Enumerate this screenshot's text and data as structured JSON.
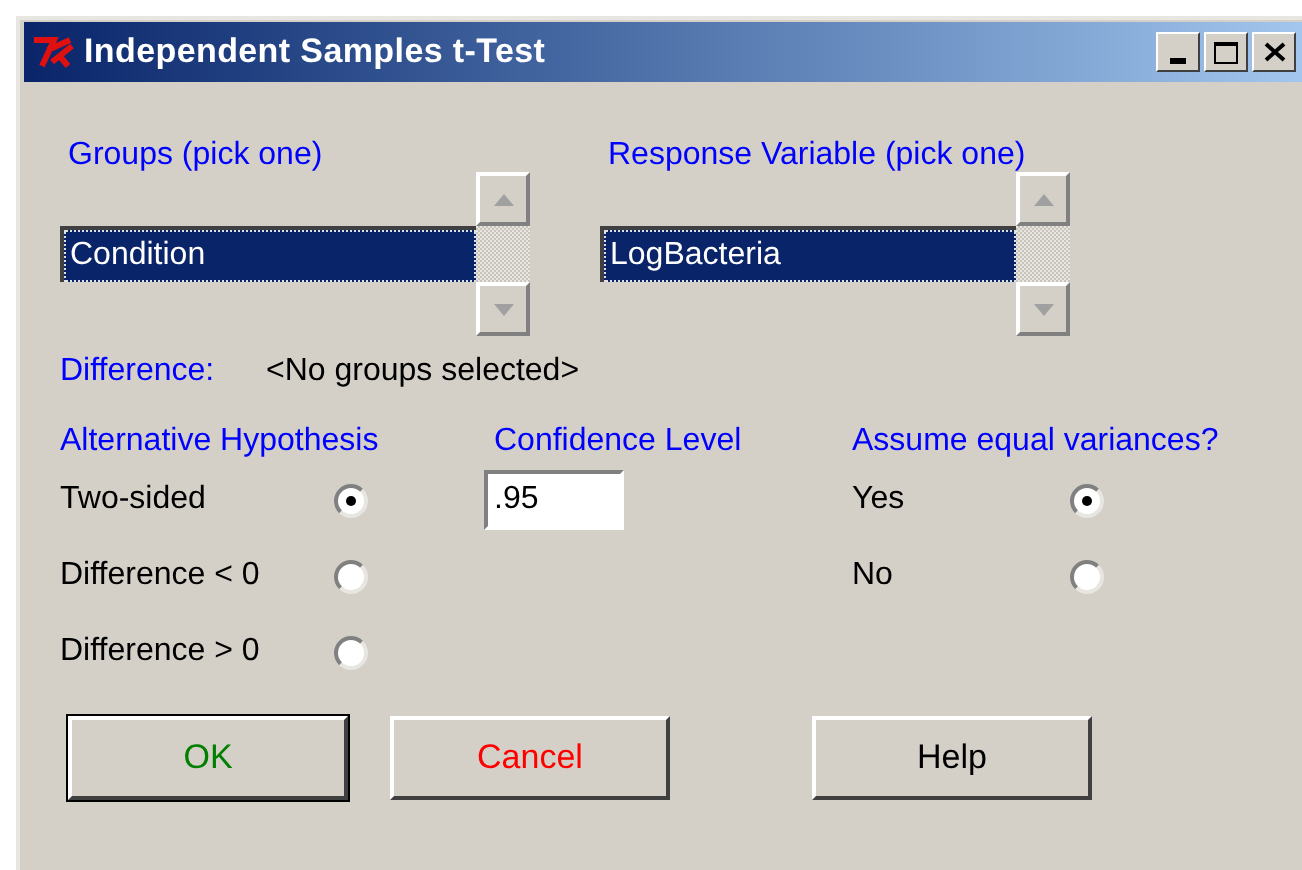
{
  "window": {
    "title": "Independent Samples t-Test"
  },
  "groups": {
    "label": "Groups (pick one)",
    "items": [
      {
        "text": "Condition",
        "selected": true
      }
    ]
  },
  "response": {
    "label": "Response Variable (pick one)",
    "items": [
      {
        "text": "LogBacteria",
        "selected": true
      }
    ]
  },
  "difference": {
    "label": "Difference:",
    "value": "<No groups selected>"
  },
  "alternative": {
    "label": "Alternative Hypothesis",
    "options": [
      {
        "label": "Two-sided",
        "selected": true
      },
      {
        "label": "Difference < 0",
        "selected": false
      },
      {
        "label": "Difference > 0",
        "selected": false
      }
    ]
  },
  "confidence": {
    "label": "Confidence Level",
    "value": ".95"
  },
  "equal_variances": {
    "label": "Assume equal variances?",
    "options": [
      {
        "label": "Yes",
        "selected": true
      },
      {
        "label": "No",
        "selected": false
      }
    ]
  },
  "buttons": [
    {
      "label": "OK",
      "kind": "ok"
    },
    {
      "label": "Cancel",
      "kind": "cancel"
    },
    {
      "label": "Help",
      "kind": "help"
    }
  ]
}
